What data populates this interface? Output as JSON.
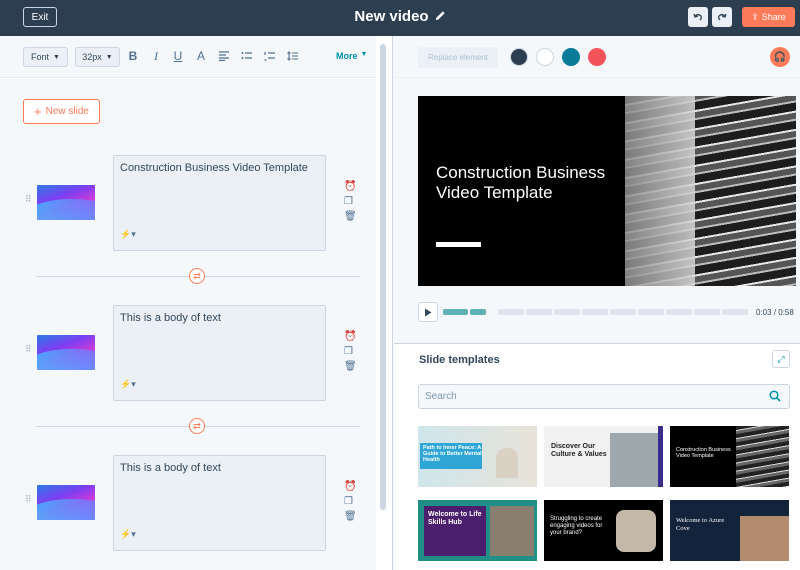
{
  "header": {
    "exit_label": "Exit",
    "title": "New video",
    "share_label": "Share"
  },
  "toolbar": {
    "font_label": "Font",
    "size_label": "32px",
    "more_label": "More"
  },
  "slides": {
    "new_slide_label": "New slide",
    "items": [
      {
        "text": "Construction Business Video Template"
      },
      {
        "text": "This is a body of text"
      },
      {
        "text": "This is a body of text"
      }
    ]
  },
  "right_toolbar": {
    "replace_label": "Replace element",
    "swatch_colors": [
      "#2d3e50",
      "#ffffff",
      "#0b7b9a",
      "#f2545b"
    ]
  },
  "preview": {
    "title": "Construction Business Video Template",
    "time": "0:03 / 0:58",
    "progress_fraction": 0.05
  },
  "templates": {
    "heading": "Slide templates",
    "search_placeholder": "Search",
    "items": [
      {
        "title": "Path to Inner Peace: A Guide to Better Mental Health"
      },
      {
        "title": "Discover Our Culture & Values"
      },
      {
        "title": "Construction Business Video Template"
      },
      {
        "title": "Welcome to Life Skills Hub"
      },
      {
        "title": "Struggling to create engaging videos for your brand?"
      },
      {
        "title": "Welcome to Azure Cove"
      }
    ]
  },
  "colors": {
    "accent": "#ff7a59",
    "header_bg": "#2d3e50",
    "link": "#0091ae"
  }
}
